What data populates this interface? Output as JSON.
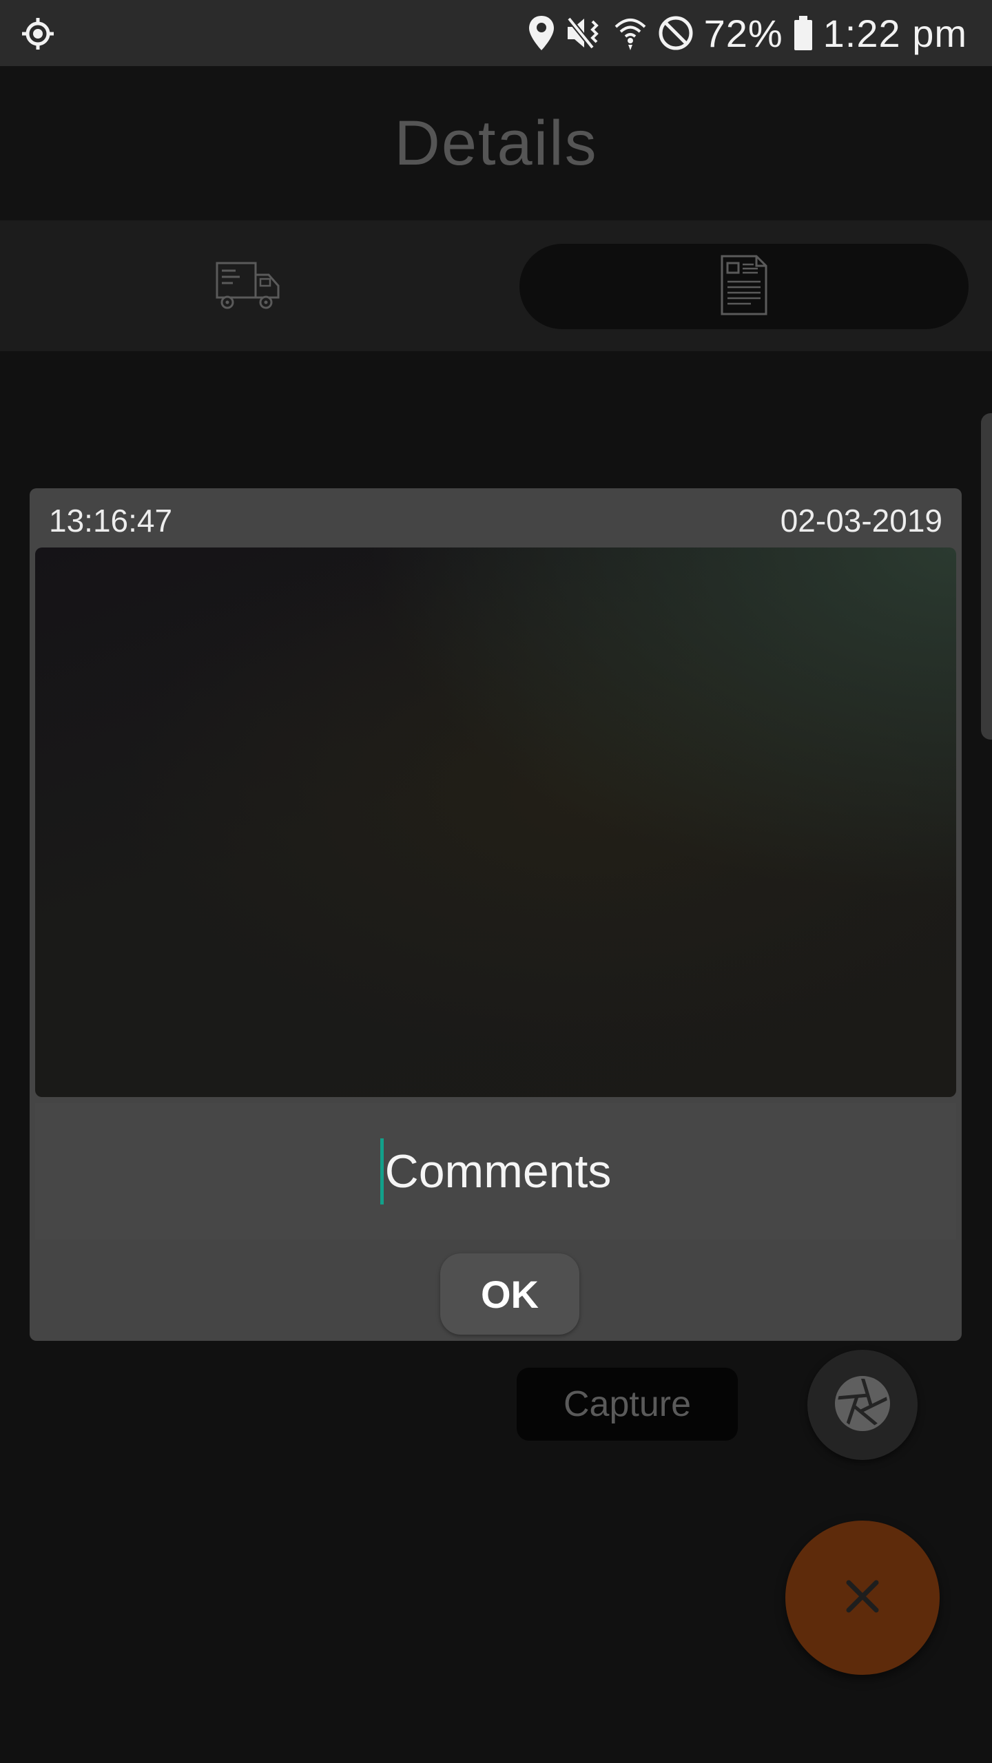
{
  "status_bar": {
    "battery_percent": "72%",
    "time": "1:22 pm",
    "icons": [
      "location-target-icon",
      "location-pin-icon",
      "vibrate-mute-icon",
      "wifi-icon",
      "do-not-disturb-icon",
      "battery-icon"
    ]
  },
  "header": {
    "title": "Details"
  },
  "tabs": [
    {
      "icon": "delivery-truck-icon",
      "selected": false
    },
    {
      "icon": "document-icon",
      "selected": true
    }
  ],
  "photo_card": {
    "time": "13:16:47",
    "date": "02-03-2019",
    "comments_placeholder": "Comments",
    "ok_label": "OK"
  },
  "actions": {
    "capture_label": "Capture",
    "camera_icon": "camera-shutter-icon",
    "close_icon": "close-icon"
  },
  "colors": {
    "background": "#111111",
    "status_bar": "#2b2b2b",
    "card": "#454545",
    "caret_accent": "#12a08a",
    "close_fab": "#5e2b0b"
  }
}
